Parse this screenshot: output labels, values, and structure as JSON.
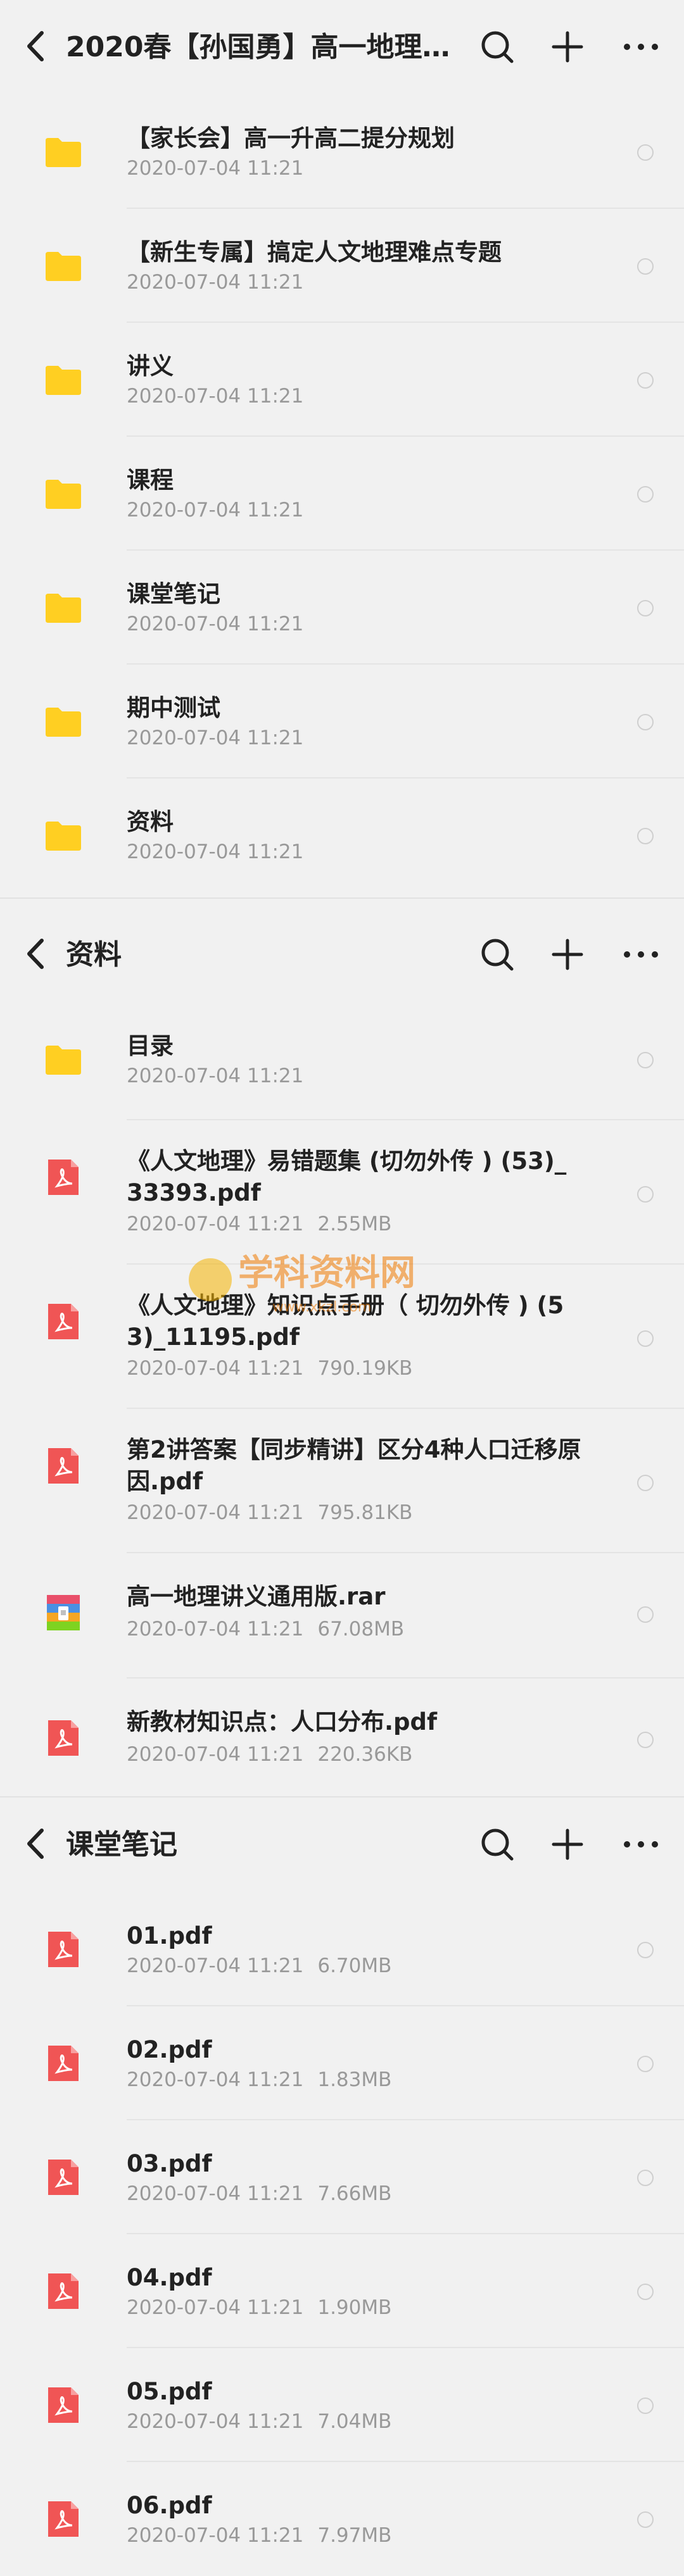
{
  "icons": {
    "back": "chevron-left-icon",
    "search": "search-icon",
    "add": "plus-icon",
    "more": "more-dots-icon",
    "folder": "folder-icon",
    "pdf": "pdf-file-icon",
    "rar": "archive-file-icon",
    "select": "radio-circle-icon"
  },
  "colors": {
    "folder": "#ffcf22",
    "pdf": "#f05555",
    "accent": "#222222"
  },
  "panel1": {
    "title": "2020春【孙国勇】高一地理…",
    "items": [
      {
        "name": "【家长会】高一升高二提分规划",
        "date": "2020-07-04  11:21",
        "size": "",
        "type": "folder"
      },
      {
        "name": "【新生专属】搞定人文地理难点专题",
        "date": "2020-07-04  11:21",
        "size": "",
        "type": "folder"
      },
      {
        "name": "讲义",
        "date": "2020-07-04  11:21",
        "size": "",
        "type": "folder"
      },
      {
        "name": "课程",
        "date": "2020-07-04  11:21",
        "size": "",
        "type": "folder"
      },
      {
        "name": "课堂笔记",
        "date": "2020-07-04  11:21",
        "size": "",
        "type": "folder"
      },
      {
        "name": "期中测试",
        "date": "2020-07-04  11:21",
        "size": "",
        "type": "folder"
      },
      {
        "name": "资料",
        "date": "2020-07-04  11:21",
        "size": "",
        "type": "folder"
      }
    ]
  },
  "panel2": {
    "title": "资料",
    "items": [
      {
        "name": "目录",
        "date": "2020-07-04  11:21",
        "size": "",
        "type": "folder"
      },
      {
        "name": "《人文地理》易错题集 (切勿外传 ) (53)_33393.pdf",
        "date": "2020-07-04  11:21",
        "size": "2.55MB",
        "type": "pdf"
      },
      {
        "name": "《人文地理》知识点手册（ 切勿外传 ) (53)_11195.pdf",
        "date": "2020-07-04  11:21",
        "size": "790.19KB",
        "type": "pdf"
      },
      {
        "name": "第2讲答案【同步精讲】区分4种人口迁移原因.pdf",
        "date": "2020-07-04  11:21",
        "size": "795.81KB",
        "type": "pdf"
      },
      {
        "name": "高一地理讲义通用版.rar",
        "date": "2020-07-04  11:21",
        "size": "67.08MB",
        "type": "rar"
      },
      {
        "name": "新教材知识点：人口分布.pdf",
        "date": "2020-07-04  11:21",
        "size": "220.36KB",
        "type": "pdf"
      }
    ]
  },
  "panel3": {
    "title": "课堂笔记",
    "items": [
      {
        "name": "01.pdf",
        "date": "2020-07-04  11:21",
        "size": "6.70MB",
        "type": "pdf"
      },
      {
        "name": "02.pdf",
        "date": "2020-07-04  11:21",
        "size": "1.83MB",
        "type": "pdf"
      },
      {
        "name": "03.pdf",
        "date": "2020-07-04  11:21",
        "size": "7.66MB",
        "type": "pdf"
      },
      {
        "name": "04.pdf",
        "date": "2020-07-04  11:21",
        "size": "1.90MB",
        "type": "pdf"
      },
      {
        "name": "05.pdf",
        "date": "2020-07-04  11:21",
        "size": "7.04MB",
        "type": "pdf"
      },
      {
        "name": "06.pdf",
        "date": "2020-07-04  11:21",
        "size": "7.97MB",
        "type": "pdf"
      }
    ]
  },
  "watermark": {
    "text": "学科资料网",
    "sub": "www.xkzl.com"
  }
}
